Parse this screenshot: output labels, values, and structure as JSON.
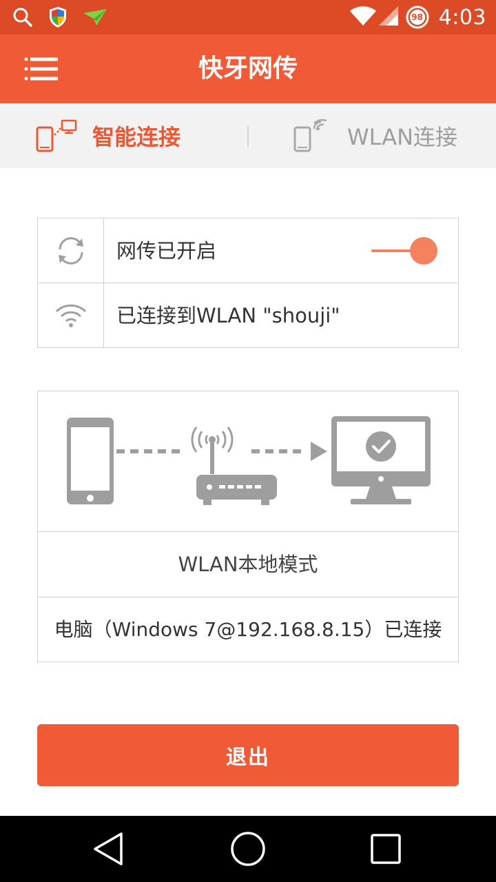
{
  "status_bar": {
    "time": "4:03",
    "battery": "98",
    "left_icons": [
      "search-icon",
      "shield-icon",
      "paper-plane-icon"
    ],
    "right_icons": [
      "wifi-icon",
      "cellular-signal-icon",
      "battery-icon"
    ]
  },
  "app_bar": {
    "title": "快牙网传",
    "menu_icon": "hamburger-menu-icon"
  },
  "tabs": [
    {
      "label": "智能连接",
      "active": true,
      "icon": "phone-to-computer-icon"
    },
    {
      "label": "WLAN连接",
      "active": false,
      "icon": "phone-wifi-icon"
    }
  ],
  "status_rows": [
    {
      "text": "网传已开启",
      "icon": "sync-icon",
      "toggle_on": true
    },
    {
      "text": "已连接到WLAN \"shouji\"",
      "icon": "wifi-icon"
    }
  ],
  "mode_card": {
    "illustration_icons": [
      "phone-icon",
      "router-icon",
      "monitor-check-icon"
    ],
    "title": "WLAN本地模式",
    "connection": "电脑（Windows 7@192.168.8.15）已连接"
  },
  "exit_button": {
    "label": "退出"
  },
  "nav_bar": {
    "icons": [
      "back-icon",
      "home-icon",
      "recents-icon"
    ]
  },
  "colors": {
    "status_bar": "#dd4b26",
    "app_bar": "#f05a36",
    "accent": "#ee5733",
    "toggle": "#f5825f",
    "illustration_gray": "#9e9e9e",
    "tab_background": "#f2f2f2"
  }
}
